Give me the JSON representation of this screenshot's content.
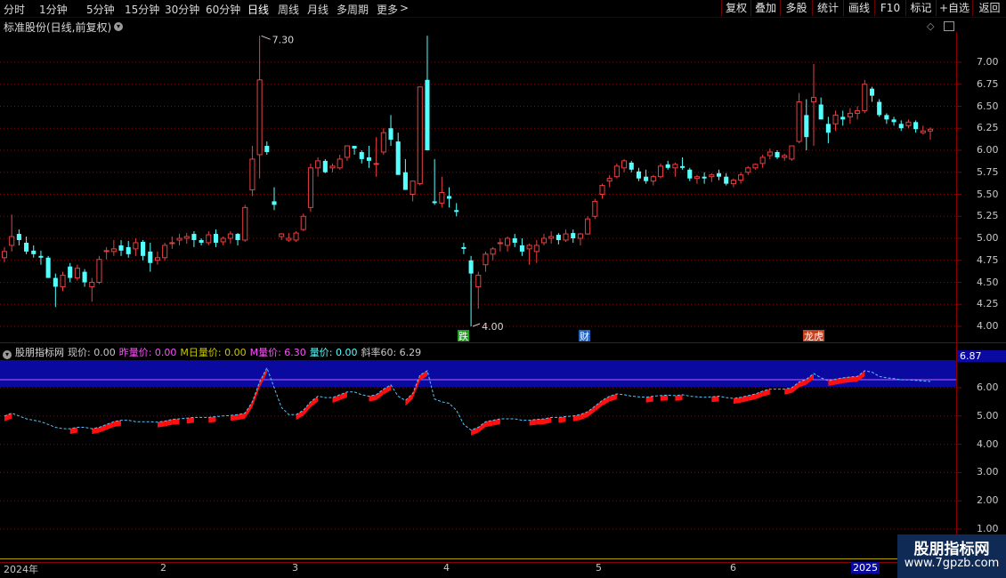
{
  "toolbar": {
    "periods": [
      "分时",
      "1分钟",
      "5分钟",
      "15分钟",
      "30分钟",
      "60分钟",
      "日线",
      "周线",
      "月线",
      "多周期",
      "更多"
    ],
    "more_arrow": ">",
    "active_period": "日线",
    "right_buttons": [
      "复权",
      "叠加",
      "多股",
      "统计",
      "画线",
      "F10",
      "标记",
      "+自选",
      "返回"
    ]
  },
  "main_chart": {
    "title": "标准股份(日线,前复权)",
    "title_icon": "chevron-down-icon",
    "y_ticks": [
      "7.00",
      "6.75",
      "6.50",
      "6.25",
      "6.00",
      "5.75",
      "5.50",
      "5.25",
      "5.00",
      "4.75",
      "4.50",
      "4.25",
      "4.00"
    ],
    "high_label": "7.30",
    "low_label": "4.00",
    "event_markers": [
      "跌",
      "财",
      "龙虎"
    ],
    "up_color": "#e84040",
    "down_color": "#54ffff"
  },
  "indicator": {
    "name": "股朋指标网",
    "fields": [
      {
        "label": "现价: 0.00",
        "color": "#c8c8c8"
      },
      {
        "label": "昨量价: 0.00",
        "color": "#ff50ff"
      },
      {
        "label": "M日量价: 0.00",
        "color": "#c8c800"
      },
      {
        "label": "M量价: 6.30",
        "color": "#ff50ff"
      },
      {
        "label": "量价: 0.00",
        "color": "#54ffff"
      },
      {
        "label": "斜率60: 6.29",
        "color": "#c8c8c8"
      }
    ],
    "current_value": "6.87",
    "y_ticks": [
      "6.00",
      "5.00",
      "4.00",
      "3.00",
      "2.00",
      "1.00"
    ],
    "band_color": "#0a0aa0"
  },
  "date_axis": {
    "labels": [
      "2024年",
      "2",
      "3",
      "4",
      "5",
      "6",
      "2025"
    ]
  },
  "watermark": {
    "title": "股朋指标网",
    "url": "www.7gpzb.com"
  },
  "chart_data": {
    "type": "candlestick",
    "title": "标准股份(日线,前复权)",
    "ylim": [
      3.9,
      7.35
    ],
    "ohlc": [
      [
        4.78,
        4.9,
        4.73,
        4.85
      ],
      [
        4.92,
        5.27,
        4.85,
        5.02
      ],
      [
        5.05,
        5.1,
        4.92,
        4.98
      ],
      [
        4.95,
        5.02,
        4.82,
        4.85
      ],
      [
        4.86,
        4.92,
        4.78,
        4.82
      ],
      [
        4.8,
        4.86,
        4.7,
        4.78
      ],
      [
        4.78,
        4.8,
        4.55,
        4.55
      ],
      [
        4.55,
        4.6,
        4.22,
        4.45
      ],
      [
        4.45,
        4.62,
        4.4,
        4.58
      ],
      [
        4.68,
        4.72,
        4.5,
        4.55
      ],
      [
        4.55,
        4.7,
        4.52,
        4.66
      ],
      [
        4.62,
        4.65,
        4.45,
        4.5
      ],
      [
        4.45,
        4.55,
        4.28,
        4.5
      ],
      [
        4.5,
        4.8,
        4.48,
        4.76
      ],
      [
        4.86,
        4.9,
        4.76,
        4.86
      ],
      [
        4.85,
        4.98,
        4.8,
        4.88
      ],
      [
        4.92,
        4.98,
        4.8,
        4.86
      ],
      [
        4.9,
        4.97,
        4.78,
        4.82
      ],
      [
        4.88,
        5.0,
        4.8,
        4.95
      ],
      [
        4.96,
        4.98,
        4.75,
        4.8
      ],
      [
        4.85,
        4.95,
        4.62,
        4.72
      ],
      [
        4.75,
        4.85,
        4.7,
        4.78
      ],
      [
        4.78,
        4.95,
        4.75,
        4.92
      ],
      [
        4.95,
        5.02,
        4.88,
        4.95
      ],
      [
        4.98,
        5.05,
        4.92,
        5.0
      ],
      [
        5.0,
        5.06,
        4.94,
        5.02
      ],
      [
        5.05,
        5.08,
        4.9,
        4.98
      ],
      [
        4.98,
        5.0,
        4.92,
        4.95
      ],
      [
        4.95,
        5.08,
        4.92,
        5.04
      ],
      [
        5.05,
        5.1,
        4.9,
        4.95
      ],
      [
        4.96,
        5.02,
        4.92,
        5.0
      ],
      [
        5.0,
        5.08,
        4.94,
        5.05
      ],
      [
        5.05,
        5.06,
        4.92,
        4.98
      ],
      [
        4.98,
        5.38,
        4.96,
        5.35
      ],
      [
        5.55,
        6.05,
        5.48,
        5.9
      ],
      [
        5.95,
        7.3,
        5.68,
        6.8
      ],
      [
        6.05,
        6.1,
        5.95,
        5.98
      ],
      [
        5.42,
        5.58,
        5.32,
        5.38
      ],
      [
        5.02,
        5.06,
        4.98,
        5.05
      ],
      [
        4.98,
        5.06,
        4.96,
        5.0
      ],
      [
        4.98,
        5.08,
        4.96,
        5.06
      ],
      [
        5.1,
        5.28,
        5.08,
        5.25
      ],
      [
        5.35,
        5.85,
        5.3,
        5.8
      ],
      [
        5.8,
        5.92,
        5.7,
        5.88
      ],
      [
        5.88,
        5.9,
        5.74,
        5.75
      ],
      [
        5.8,
        5.85,
        5.75,
        5.82
      ],
      [
        5.8,
        5.95,
        5.78,
        5.9
      ],
      [
        5.92,
        6.05,
        5.88,
        6.05
      ],
      [
        6.05,
        6.05,
        5.95,
        6.02
      ],
      [
        5.98,
        6.0,
        5.85,
        5.9
      ],
      [
        5.92,
        6.05,
        5.8,
        5.88
      ],
      [
        5.85,
        6.15,
        5.7,
        5.85
      ],
      [
        5.98,
        6.25,
        5.95,
        6.2
      ],
      [
        6.25,
        6.4,
        6.05,
        6.12
      ],
      [
        6.1,
        6.2,
        5.95,
        5.72
      ],
      [
        5.75,
        5.9,
        5.55,
        5.55
      ],
      [
        5.5,
        5.62,
        5.42,
        5.65
      ],
      [
        5.62,
        6.72,
        5.6,
        6.72
      ],
      [
        6.8,
        7.3,
        6.0,
        6.0
      ],
      [
        5.42,
        5.9,
        5.38,
        5.4
      ],
      [
        5.4,
        5.7,
        5.35,
        5.52
      ],
      [
        5.48,
        5.58,
        5.35,
        5.45
      ],
      [
        5.32,
        5.4,
        5.25,
        5.3
      ],
      [
        4.9,
        4.95,
        4.82,
        4.88
      ],
      [
        4.75,
        4.8,
        4.0,
        4.6
      ],
      [
        4.45,
        4.62,
        4.2,
        4.58
      ],
      [
        4.7,
        4.85,
        4.62,
        4.82
      ],
      [
        4.82,
        4.9,
        4.75,
        4.88
      ],
      [
        4.95,
        5.0,
        4.85,
        4.95
      ],
      [
        4.92,
        5.02,
        4.85,
        5.0
      ],
      [
        5.0,
        5.05,
        4.9,
        4.95
      ],
      [
        4.92,
        5.0,
        4.8,
        4.85
      ],
      [
        4.88,
        4.94,
        4.7,
        4.92
      ],
      [
        4.85,
        4.98,
        4.72,
        4.92
      ],
      [
        4.95,
        5.05,
        4.92,
        5.0
      ],
      [
        5.0,
        5.08,
        4.94,
        5.02
      ],
      [
        5.04,
        5.06,
        4.93,
        4.98
      ],
      [
        4.98,
        5.1,
        4.96,
        5.05
      ],
      [
        5.06,
        5.1,
        4.95,
        5.0
      ],
      [
        5.0,
        5.06,
        4.92,
        5.05
      ],
      [
        5.05,
        5.25,
        5.04,
        5.22
      ],
      [
        5.25,
        5.45,
        5.22,
        5.42
      ],
      [
        5.5,
        5.62,
        5.45,
        5.6
      ],
      [
        5.65,
        5.72,
        5.58,
        5.68
      ],
      [
        5.7,
        5.85,
        5.68,
        5.82
      ],
      [
        5.8,
        5.9,
        5.75,
        5.88
      ],
      [
        5.86,
        5.88,
        5.75,
        5.78
      ],
      [
        5.76,
        5.8,
        5.65,
        5.68
      ],
      [
        5.7,
        5.78,
        5.62,
        5.65
      ],
      [
        5.65,
        5.72,
        5.6,
        5.7
      ],
      [
        5.7,
        5.85,
        5.68,
        5.82
      ],
      [
        5.84,
        5.88,
        5.78,
        5.8
      ],
      [
        5.8,
        5.86,
        5.7,
        5.84
      ],
      [
        5.82,
        5.92,
        5.78,
        5.8
      ],
      [
        5.78,
        5.8,
        5.65,
        5.68
      ],
      [
        5.68,
        5.72,
        5.62,
        5.7
      ],
      [
        5.7,
        5.75,
        5.62,
        5.68
      ],
      [
        5.7,
        5.74,
        5.64,
        5.72
      ],
      [
        5.74,
        5.78,
        5.66,
        5.7
      ],
      [
        5.7,
        5.74,
        5.6,
        5.62
      ],
      [
        5.62,
        5.68,
        5.58,
        5.66
      ],
      [
        5.66,
        5.75,
        5.62,
        5.72
      ],
      [
        5.75,
        5.82,
        5.72,
        5.8
      ],
      [
        5.8,
        5.85,
        5.78,
        5.84
      ],
      [
        5.85,
        5.95,
        5.8,
        5.92
      ],
      [
        5.94,
        6.02,
        5.9,
        5.98
      ],
      [
        5.98,
        6.0,
        5.9,
        5.92
      ],
      [
        5.92,
        5.96,
        5.88,
        5.94
      ],
      [
        5.9,
        6.05,
        5.88,
        6.05
      ],
      [
        6.1,
        6.65,
        6.08,
        6.55
      ],
      [
        6.4,
        6.58,
        6.0,
        6.15
      ],
      [
        6.55,
        6.98,
        6.05,
        6.6
      ],
      [
        6.52,
        6.6,
        6.35,
        6.35
      ],
      [
        6.3,
        6.38,
        6.08,
        6.2
      ],
      [
        6.3,
        6.45,
        6.22,
        6.4
      ],
      [
        6.38,
        6.45,
        6.28,
        6.35
      ],
      [
        6.38,
        6.48,
        6.3,
        6.42
      ],
      [
        6.42,
        6.5,
        6.35,
        6.45
      ],
      [
        6.45,
        6.8,
        6.42,
        6.75
      ],
      [
        6.7,
        6.72,
        6.55,
        6.62
      ],
      [
        6.55,
        6.58,
        6.38,
        6.4
      ],
      [
        6.4,
        6.42,
        6.3,
        6.35
      ],
      [
        6.35,
        6.38,
        6.28,
        6.32
      ],
      [
        6.3,
        6.34,
        6.22,
        6.25
      ],
      [
        6.28,
        6.35,
        6.25,
        6.32
      ],
      [
        6.32,
        6.34,
        6.2,
        6.24
      ],
      [
        6.2,
        6.28,
        6.18,
        6.22
      ],
      [
        6.22,
        6.26,
        6.12,
        6.24
      ]
    ],
    "indicator_line": [
      5.0,
      5.1,
      5.0,
      4.9,
      4.85,
      4.8,
      4.7,
      4.6,
      4.55,
      4.55,
      4.6,
      4.6,
      4.55,
      4.6,
      4.7,
      4.8,
      4.85,
      4.85,
      4.8,
      4.8,
      4.8,
      4.78,
      4.82,
      4.88,
      4.9,
      4.92,
      4.95,
      4.95,
      4.95,
      4.98,
      5.0,
      5.02,
      5.05,
      5.1,
      5.5,
      6.2,
      6.7,
      6.0,
      5.3,
      5.05,
      5.05,
      5.2,
      5.5,
      5.7,
      5.65,
      5.65,
      5.75,
      5.85,
      5.85,
      5.75,
      5.7,
      5.75,
      5.95,
      6.1,
      5.7,
      5.55,
      5.8,
      6.45,
      6.6,
      5.6,
      5.5,
      5.45,
      5.2,
      4.7,
      4.5,
      4.6,
      4.8,
      4.85,
      4.9,
      4.9,
      4.9,
      4.85,
      4.85,
      4.88,
      4.9,
      4.95,
      4.95,
      4.98,
      5.0,
      5.05,
      5.15,
      5.35,
      5.55,
      5.7,
      5.78,
      5.75,
      5.7,
      5.68,
      5.66,
      5.7,
      5.72,
      5.74,
      5.72,
      5.75,
      5.7,
      5.68,
      5.66,
      5.68,
      5.7,
      5.65,
      5.62,
      5.66,
      5.72,
      5.78,
      5.88,
      5.95,
      5.95,
      5.95,
      6.0,
      6.2,
      6.3,
      6.5,
      6.35,
      6.25,
      6.3,
      6.35,
      6.38,
      6.4,
      6.6,
      6.55,
      6.4,
      6.35,
      6.32,
      6.28,
      6.28,
      6.26,
      6.24,
      6.22
    ]
  }
}
